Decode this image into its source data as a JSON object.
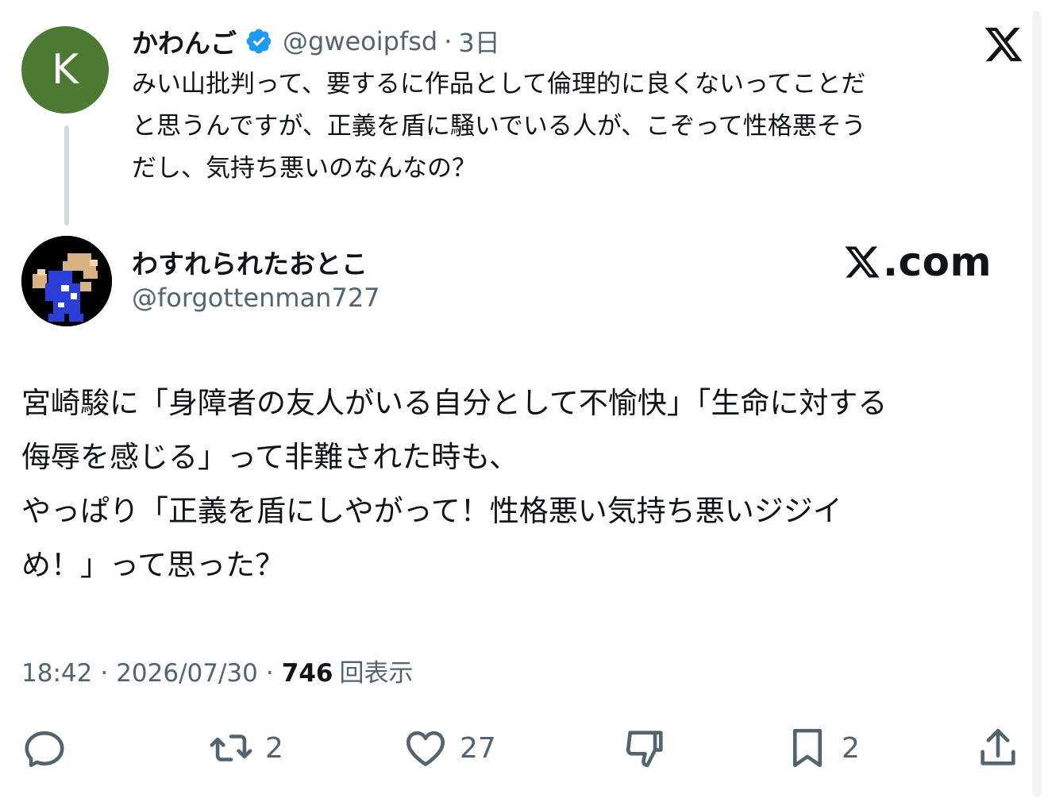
{
  "parent_tweet": {
    "avatar_letter": "K",
    "display_name": "かわんご",
    "handle": "@gweoipfsd",
    "separator": "·",
    "time_ago": "3日",
    "text": "みい山批判って、要するに作品として倫理的に良くないってことだ\nと思うんですが、正義を盾に騒いでいる人が、こぞって性格悪そう\nだし、気持ち悪いのなんなの？",
    "verified": true
  },
  "reply_tweet": {
    "display_name": "わすれられたおとこ",
    "handle": "@forgottenman727",
    "text": "宮崎駿に「身障者の友人がいる自分として不愉快」「生命に対する\n侮辱を感じる」って非難された時も、\nやっぱり「正義を盾にしやがって！性格悪い気持ち悪いジジイ\nめ！」って思った？",
    "time": "18:42",
    "date": "2026/07/30",
    "separator": "·",
    "views_count": "746",
    "views_label": "回表示"
  },
  "watermark": {
    "domain_text": ".com"
  },
  "actions": {
    "reply_count": "",
    "retweet_count": "2",
    "like_count": "27",
    "bookmark_count": "2"
  },
  "icons": {
    "verified": "verified-badge-icon",
    "x_logo": "x-logo-icon",
    "reply": "reply-icon",
    "retweet": "retweet-icon",
    "like": "heart-icon",
    "downvote": "downvote-icon",
    "bookmark": "bookmark-icon",
    "share": "share-icon"
  },
  "colors": {
    "avatar_k_bg": "#4d7a32",
    "verified_blue": "#1d9bf0",
    "gray_text": "#536471",
    "main_text": "#0f1419"
  }
}
